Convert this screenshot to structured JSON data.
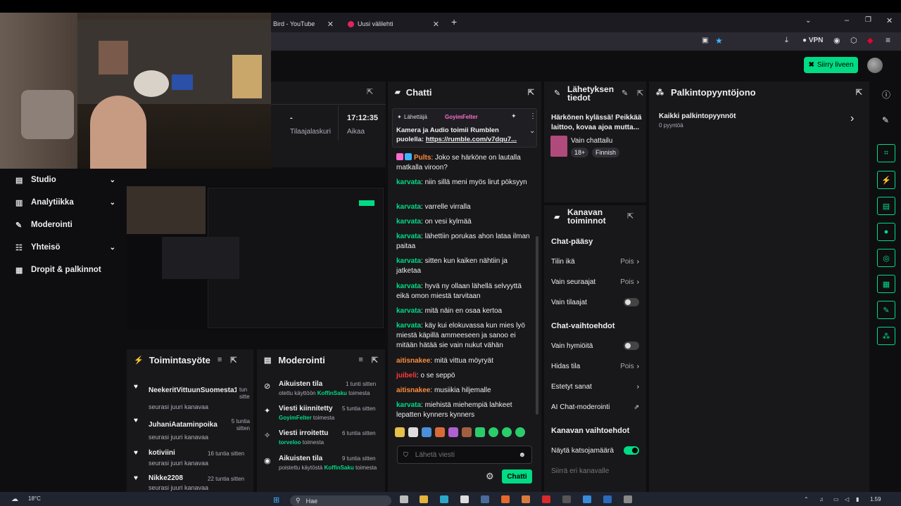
{
  "browser": {
    "tabs": [
      {
        "label": "Bird - YouTube"
      },
      {
        "label": "Uusi välilehti"
      }
    ],
    "new_tab": "+",
    "vpn_label": "VPN"
  },
  "header": {
    "go_live_label": "Siirry liveen"
  },
  "nav": {
    "items": [
      {
        "label": "Studio",
        "has_chevron": true
      },
      {
        "label": "Analytiikka",
        "has_chevron": true
      },
      {
        "label": "Moderointi",
        "has_chevron": false
      },
      {
        "label": "Yhteisö",
        "has_chevron": true
      },
      {
        "label": "Dropit & palkinnot",
        "has_chevron": false
      }
    ]
  },
  "stats": {
    "value1": "-",
    "label1": "Tilaajalaskuri",
    "value2": "17:12:35",
    "label2": "Aikaa"
  },
  "chat": {
    "title": "Chatti",
    "pinned": {
      "sender_label": "Lähettäjä",
      "sender": "GoyimFelter",
      "text": "Kamera ja Audio toimii Rumblen puolella: ",
      "link": "https://rumble.com/v7dqu7..."
    },
    "messages": [
      {
        "user": "Pults",
        "color": "pink",
        "text": "Joko se härköne on lautalla matkalla viroon?"
      },
      {
        "user": "karvata",
        "color": "green",
        "text": "niin sillä meni myös lirut pöksyyn"
      },
      {
        "user": "karvata",
        "color": "green",
        "text": "varrelle virralla"
      },
      {
        "user": "karvata",
        "color": "green",
        "text": "on vesi kylmää"
      },
      {
        "user": "karvata",
        "color": "green",
        "text": "lähettiin porukas ahon lataa ilman paitaa"
      },
      {
        "user": "karvata",
        "color": "green",
        "text": "sitten kun kaiken nähtiin ja jatketaa"
      },
      {
        "user": "karvata",
        "color": "green",
        "text": "hyvä ny ollaan lähellä selvyyttä eikä omon miestä tarvitaan"
      },
      {
        "user": "karvata",
        "color": "green",
        "text": "mitä näin en osaa kertoa"
      },
      {
        "user": "karvata",
        "color": "green",
        "text": "käy kui elokuvassa kun mies lyö miestä käpillä ammeeseen ja sanoo ei mitään hätää sie vain nukut vähän"
      },
      {
        "user": "aitisnakee",
        "color": "orange",
        "text": "mitä vittua möyryät"
      },
      {
        "user": "juibeli",
        "color": "red",
        "text": "o se seppö"
      },
      {
        "user": "aitisnakee",
        "color": "orange",
        "text": "musiikia hiljemalle"
      },
      {
        "user": "karvata",
        "color": "green",
        "text": "miehistä miehempiä lahkeet lepatten kynners kynners"
      }
    ],
    "input_placeholder": "Lähetä viesti",
    "send_label": "Chatti"
  },
  "stream_info": {
    "title": "Lähetyksen tiedot",
    "description": "Härkönen kylässä! Peikkää laittoo, kovaa ajoa mutta...",
    "category": "Vain chattailu",
    "tags": [
      "18+",
      "Finnish"
    ]
  },
  "channel_actions": {
    "title": "Kanavan toiminnot",
    "section1": "Chat-pääsy",
    "section2": "Chat-vaihtoehdot",
    "section3": "Kanavan vaihtoehdot",
    "rows1": [
      {
        "label": "Tilin ikä",
        "value": "Pois"
      },
      {
        "label": "Vain seuraajat",
        "value": "Pois"
      },
      {
        "label": "Vain tilaajat",
        "toggle": false
      }
    ],
    "rows2": [
      {
        "label": "Vain hymiöitä",
        "toggle": false
      },
      {
        "label": "Hidas tila",
        "value": "Pois"
      },
      {
        "label": "Estetyt sanat",
        "value": ""
      },
      {
        "label": "AI Chat-moderointi",
        "value": ""
      }
    ],
    "rows3": [
      {
        "label": "Näytä katsojamäärä",
        "toggle": true
      },
      {
        "label": "Siirrä eri kanavalle",
        "value": ""
      }
    ]
  },
  "rewards": {
    "title": "Palkintopyyntöjono",
    "all_label": "Kaikki palkintopyynnöt",
    "count": "0 pyyntöä"
  },
  "activity": {
    "title": "Toimintasyöte",
    "items": [
      {
        "name": "NeekeritVittuunSuomesta17",
        "action": "seurasi juuri kanavaa",
        "time": "tun sitte"
      },
      {
        "name": "JuhaniAataminpoika",
        "action": "seurasi juuri kanavaa",
        "time": "5 tuntia sitten"
      },
      {
        "name": "kotiviini",
        "action": "seurasi juuri kanavaa",
        "time": "16 tuntia sitten"
      },
      {
        "name": "Nikke2208",
        "action": "seurasi juuri kanavaa",
        "time": "22 tuntia sitten"
      }
    ]
  },
  "moderation": {
    "title": "Moderointi",
    "items": [
      {
        "title": "Aikuisten tila",
        "pre": "otettu käyttöön ",
        "user": "KoffinSaku",
        "post": " toimesta",
        "time": "1 tunti sitten"
      },
      {
        "title": "Viesti kiinnitetty",
        "pre": "",
        "user": "GoyimFelter",
        "post": " toimesta",
        "time": "5 tuntia sitten"
      },
      {
        "title": "Viesti irroitettu",
        "pre": "",
        "user": "torveloo",
        "post": " toimesta",
        "time": "6 tuntia sitten"
      },
      {
        "title": "Aikuisten tila",
        "pre": "poistettu käytöstä ",
        "user": "KoffinSaku",
        "post": " toimesta",
        "time": "9 tuntia sitten"
      }
    ]
  },
  "taskbar": {
    "weather": "18°C",
    "search_placeholder": "Hae",
    "clock": "1.59"
  }
}
